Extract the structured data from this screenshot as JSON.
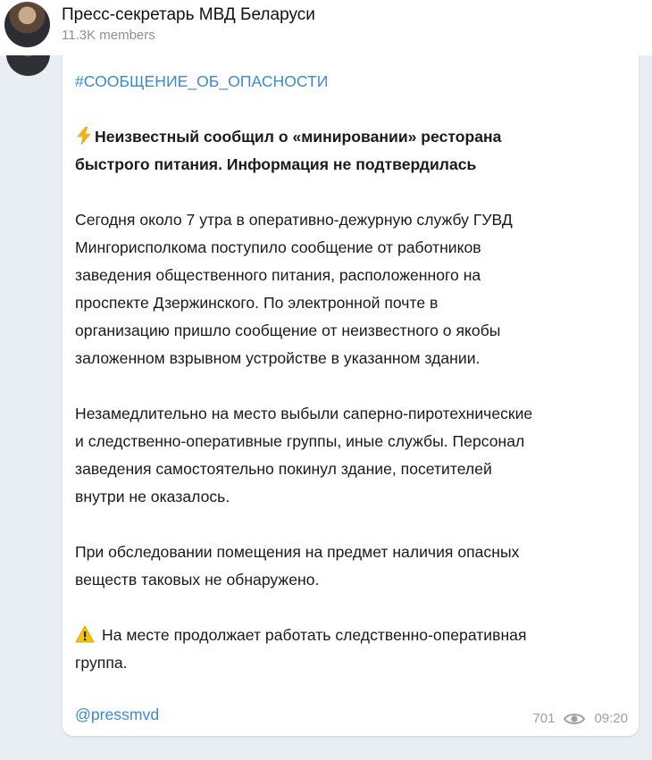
{
  "header": {
    "title": "Пресс-секретарь МВД Беларуси",
    "members": "11.3K members"
  },
  "message": {
    "hashtag": "#СООБЩЕНИЕ_ОБ_ОПАСНОСТИ",
    "headline_line1": "Неизвестный сообщил о «минировании» ресторана",
    "headline_line2": "быстрого питания. Информация не подтвердилась",
    "paragraph1": [
      "Сегодня около 7 утра в оперативно-дежурную службу ГУВД",
      "Мингорисполкома поступило сообщение от работников",
      "заведения общественного питания, расположенного на",
      "проспекте Дзержинского. По электронной почте в",
      "организацию пришло сообщение от неизвестного о якобы",
      "заложенном взрывном устройстве в указанном здании."
    ],
    "paragraph2": [
      "Незамедлительно на место выбыли саперно-пиротехнические",
      "и следственно-оперативные группы, иные службы. Персонал",
      "заведения самостоятельно покинул здание, посетителей",
      "внутри не оказалось."
    ],
    "paragraph3": [
      "При обследовании помещения на предмет наличия опасных",
      "веществ таковых не обнаружено."
    ],
    "paragraph4": [
      "На месте продолжает работать следственно-оперативная",
      "группа."
    ],
    "signature": "@pressmvd",
    "views": "701",
    "time": "09:20"
  },
  "icons": {
    "headline_emoji": "lightning-icon",
    "warning_emoji": "warning-icon",
    "views_icon": "eye-icon"
  },
  "colors": {
    "background": "#e9eef2",
    "link": "#3b8ad0",
    "meta": "#9aa1a8"
  }
}
